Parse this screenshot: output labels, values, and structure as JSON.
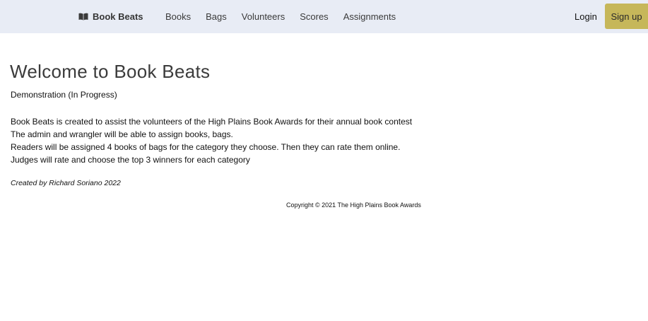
{
  "navbar": {
    "brand": {
      "icon": "open-book-icon",
      "label": "Book Beats"
    },
    "links": [
      {
        "label": "Books"
      },
      {
        "label": "Bags"
      },
      {
        "label": "Volunteers"
      },
      {
        "label": "Scores"
      },
      {
        "label": "Assignments"
      }
    ],
    "login_label": "Login",
    "signup_label": "Sign up",
    "colors": {
      "background": "#e8ecf5",
      "signup_button": "#c6b75a"
    }
  },
  "main": {
    "title": "Welcome to Book Beats",
    "subtitle": "Demonstration (In Progress)",
    "description": [
      "Book Beats is created to assist the volunteers of the High Plains Book Awards for their annual book contest",
      "The admin and wrangler will be able to assign books, bags.",
      "Readers will be assigned 4 books of bags for the category they choose. Then they can rate them online.",
      "Judges will rate and choose the top 3 winners for each category"
    ],
    "credit": "Created by Richard Soriano 2022"
  },
  "footer": {
    "copyright": "Copyright © 2021 The High Plains Book Awards"
  }
}
